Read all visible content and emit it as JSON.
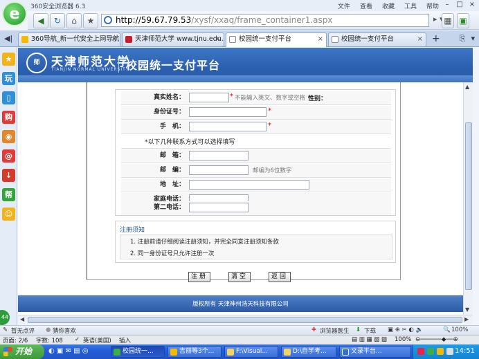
{
  "window": {
    "title": "360安全浏览器 6.3",
    "menus": [
      "文件",
      "查看",
      "收藏",
      "工具",
      "帮助"
    ]
  },
  "address": {
    "host": "http://59.67.79.53",
    "path": "/xysf/xxaq/frame_container1.aspx"
  },
  "tabs": [
    {
      "label": "360导航_新一代安全上网导航",
      "active": false
    },
    {
      "label": "天津师范大学 www.tjnu.edu.cn",
      "active": false
    },
    {
      "label": "校园统一支付平台",
      "active": true
    },
    {
      "label": "校园统一支付平台",
      "active": false
    }
  ],
  "sidebar_icons": [
    {
      "name": "favorites-star-icon",
      "glyph": "★",
      "color": "#f2b31c"
    },
    {
      "name": "play-icon",
      "glyph": "玩",
      "color": "#2f8fd8"
    },
    {
      "name": "book-icon",
      "glyph": "▯",
      "color": "#2f8fd8"
    },
    {
      "name": "shopping-icon",
      "glyph": "购",
      "color": "#e23a36"
    },
    {
      "name": "weibo-icon",
      "glyph": "◉",
      "color": "#e2882c"
    },
    {
      "name": "email-icon",
      "glyph": "@",
      "color": "#e23a36"
    },
    {
      "name": "download-icon",
      "glyph": "↓",
      "color": "#d63a2a"
    },
    {
      "name": "help-icon",
      "glyph": "帮",
      "color": "#34a53a"
    },
    {
      "name": "emoji-icon",
      "glyph": "☺",
      "color": "#f2b31c"
    }
  ],
  "banner": {
    "university_cn": "天津师范大学",
    "university_en": "TIANJIN NORMAL UNIVERSITY",
    "emblem": "师",
    "portal_title": "校园统一支付平台"
  },
  "form": {
    "name_label": "真实姓名：",
    "name_hint": "不能输入英文、数字或空格",
    "gender_label": "性别：",
    "id_label": "身份证号：",
    "phone_label": "手　机：",
    "optional_note": "*以下几种联系方式可以选择填写",
    "email_label": "邮　箱：",
    "zip_label": "邮　编：",
    "zip_hint": "邮编为6位数字",
    "address_label": "地　址：",
    "home_phone_label": "家庭电话：",
    "second_phone_label": "第二电话：",
    "required_mark": "*"
  },
  "notice": {
    "title": "注册须知",
    "items": [
      "1.  注册前请仔细阅读注册须知，并完全同意注册须知条款",
      "2.  同一身份证号只允许注册一次"
    ]
  },
  "buttons": {
    "register": "注册",
    "clear": "清空",
    "back": "返回"
  },
  "footer": {
    "copyright": "版权所有  天津神州浩天科技有限公司"
  },
  "statusbar": {
    "comments": "暂无点评",
    "like": "猜你喜欢",
    "doctor": "浏览器医生",
    "download": "下载",
    "zoom": "100%"
  },
  "wordbar": {
    "page": "页面: 2/6",
    "words": "字数: 108",
    "language": "英语(美国)",
    "mode": "插入",
    "zoom": "100%"
  },
  "taskbar": {
    "start": "开始",
    "buttons": [
      {
        "label": "校园统一...",
        "active": true
      },
      {
        "label": "吉丽等3个...",
        "active": false
      },
      {
        "label": "F:\\Visual...",
        "active": false
      },
      {
        "label": "D:\\自学考...",
        "active": false
      },
      {
        "label": "文录平台...",
        "active": false
      }
    ],
    "clock": "14:51"
  }
}
